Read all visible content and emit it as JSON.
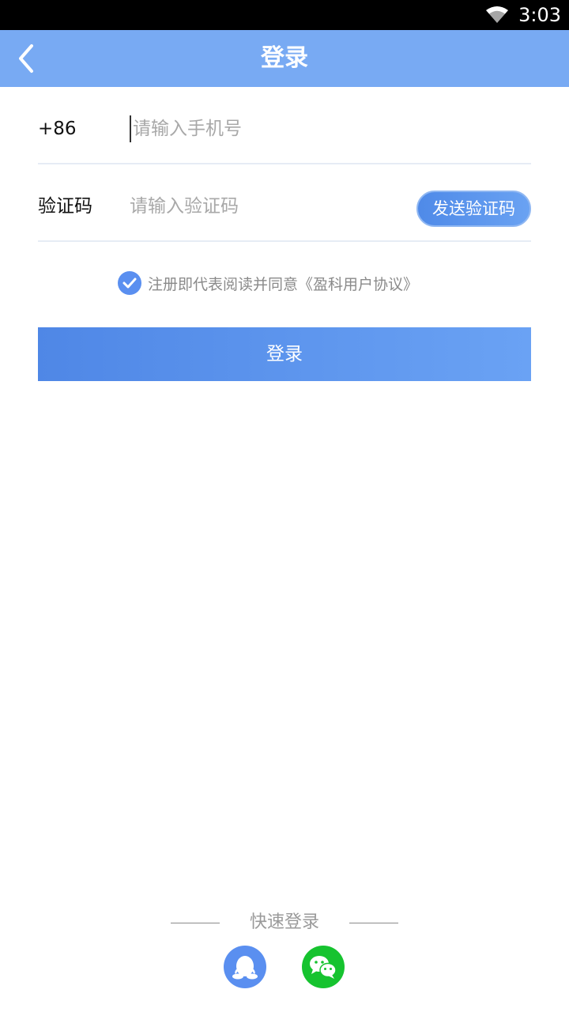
{
  "status_bar": {
    "time": "3:03"
  },
  "app_bar": {
    "title": "登录"
  },
  "phone_row": {
    "prefix": "+86",
    "placeholder": "请输入手机号"
  },
  "code_row": {
    "label": "验证码",
    "placeholder": "请输入验证码",
    "send_button": "发送验证码"
  },
  "agreement": {
    "text": "注册即代表阅读并同意《盈科用户协议》",
    "checked": true
  },
  "login_button": {
    "label": "登录"
  },
  "quick_login": {
    "label": "快速登录"
  },
  "icons": {
    "back": "chevron-left-icon",
    "wifi": "wifi-icon",
    "check": "check-circle-icon",
    "qq": "qq-icon",
    "wechat": "wechat-icon"
  },
  "colors": {
    "app_bar": "#78aaf3",
    "primary": "#5a8ff0",
    "wechat": "#16c32f"
  }
}
